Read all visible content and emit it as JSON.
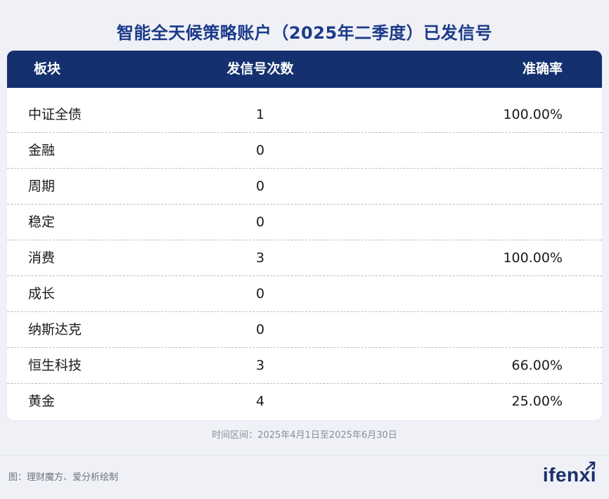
{
  "title": "智能全天候策略账户（2025年二季度）已发信号",
  "table": {
    "headers": {
      "block": "板块",
      "count": "发信号次数",
      "rate": "准确率"
    },
    "rows": [
      {
        "block": "中证全债",
        "count": "1",
        "rate": "100.00%"
      },
      {
        "block": "金融",
        "count": "0",
        "rate": ""
      },
      {
        "block": "周期",
        "count": "0",
        "rate": ""
      },
      {
        "block": "稳定",
        "count": "0",
        "rate": ""
      },
      {
        "block": "消费",
        "count": "3",
        "rate": "100.00%"
      },
      {
        "block": "成长",
        "count": "0",
        "rate": ""
      },
      {
        "block": "纳斯达克",
        "count": "0",
        "rate": ""
      },
      {
        "block": "恒生科技",
        "count": "3",
        "rate": "66.00%"
      },
      {
        "block": "黄金",
        "count": "4",
        "rate": "25.00%"
      }
    ]
  },
  "period": "时间区间：2025年4月1日至2025年6月30日",
  "source": "图：理财魔方、爱分析绘制",
  "logo": "ifenxi",
  "colors": {
    "header_bg": "#14306e",
    "title": "#1c3a8a",
    "page_bg": "#eff1f6"
  }
}
